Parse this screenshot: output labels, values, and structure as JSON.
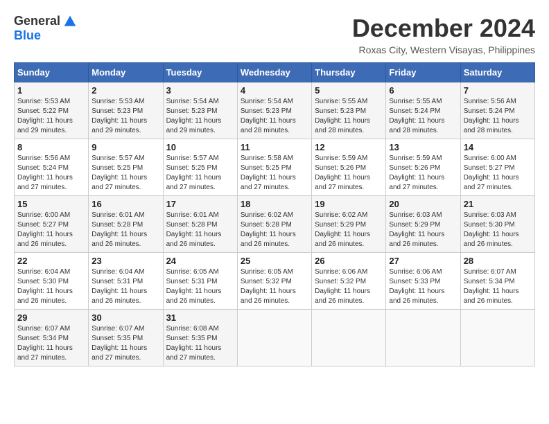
{
  "logo": {
    "general": "General",
    "blue": "Blue"
  },
  "title": {
    "month_year": "December 2024",
    "location": "Roxas City, Western Visayas, Philippines"
  },
  "headers": [
    "Sunday",
    "Monday",
    "Tuesday",
    "Wednesday",
    "Thursday",
    "Friday",
    "Saturday"
  ],
  "weeks": [
    [
      {
        "day": "1",
        "sunrise": "5:53 AM",
        "sunset": "5:22 PM",
        "daylight": "11 hours and 29 minutes."
      },
      {
        "day": "2",
        "sunrise": "5:53 AM",
        "sunset": "5:23 PM",
        "daylight": "11 hours and 29 minutes."
      },
      {
        "day": "3",
        "sunrise": "5:54 AM",
        "sunset": "5:23 PM",
        "daylight": "11 hours and 29 minutes."
      },
      {
        "day": "4",
        "sunrise": "5:54 AM",
        "sunset": "5:23 PM",
        "daylight": "11 hours and 28 minutes."
      },
      {
        "day": "5",
        "sunrise": "5:55 AM",
        "sunset": "5:23 PM",
        "daylight": "11 hours and 28 minutes."
      },
      {
        "day": "6",
        "sunrise": "5:55 AM",
        "sunset": "5:24 PM",
        "daylight": "11 hours and 28 minutes."
      },
      {
        "day": "7",
        "sunrise": "5:56 AM",
        "sunset": "5:24 PM",
        "daylight": "11 hours and 28 minutes."
      }
    ],
    [
      {
        "day": "8",
        "sunrise": "5:56 AM",
        "sunset": "5:24 PM",
        "daylight": "11 hours and 27 minutes."
      },
      {
        "day": "9",
        "sunrise": "5:57 AM",
        "sunset": "5:25 PM",
        "daylight": "11 hours and 27 minutes."
      },
      {
        "day": "10",
        "sunrise": "5:57 AM",
        "sunset": "5:25 PM",
        "daylight": "11 hours and 27 minutes."
      },
      {
        "day": "11",
        "sunrise": "5:58 AM",
        "sunset": "5:25 PM",
        "daylight": "11 hours and 27 minutes."
      },
      {
        "day": "12",
        "sunrise": "5:59 AM",
        "sunset": "5:26 PM",
        "daylight": "11 hours and 27 minutes."
      },
      {
        "day": "13",
        "sunrise": "5:59 AM",
        "sunset": "5:26 PM",
        "daylight": "11 hours and 27 minutes."
      },
      {
        "day": "14",
        "sunrise": "6:00 AM",
        "sunset": "5:27 PM",
        "daylight": "11 hours and 27 minutes."
      }
    ],
    [
      {
        "day": "15",
        "sunrise": "6:00 AM",
        "sunset": "5:27 PM",
        "daylight": "11 hours and 26 minutes."
      },
      {
        "day": "16",
        "sunrise": "6:01 AM",
        "sunset": "5:28 PM",
        "daylight": "11 hours and 26 minutes."
      },
      {
        "day": "17",
        "sunrise": "6:01 AM",
        "sunset": "5:28 PM",
        "daylight": "11 hours and 26 minutes."
      },
      {
        "day": "18",
        "sunrise": "6:02 AM",
        "sunset": "5:28 PM",
        "daylight": "11 hours and 26 minutes."
      },
      {
        "day": "19",
        "sunrise": "6:02 AM",
        "sunset": "5:29 PM",
        "daylight": "11 hours and 26 minutes."
      },
      {
        "day": "20",
        "sunrise": "6:03 AM",
        "sunset": "5:29 PM",
        "daylight": "11 hours and 26 minutes."
      },
      {
        "day": "21",
        "sunrise": "6:03 AM",
        "sunset": "5:30 PM",
        "daylight": "11 hours and 26 minutes."
      }
    ],
    [
      {
        "day": "22",
        "sunrise": "6:04 AM",
        "sunset": "5:30 PM",
        "daylight": "11 hours and 26 minutes."
      },
      {
        "day": "23",
        "sunrise": "6:04 AM",
        "sunset": "5:31 PM",
        "daylight": "11 hours and 26 minutes."
      },
      {
        "day": "24",
        "sunrise": "6:05 AM",
        "sunset": "5:31 PM",
        "daylight": "11 hours and 26 minutes."
      },
      {
        "day": "25",
        "sunrise": "6:05 AM",
        "sunset": "5:32 PM",
        "daylight": "11 hours and 26 minutes."
      },
      {
        "day": "26",
        "sunrise": "6:06 AM",
        "sunset": "5:32 PM",
        "daylight": "11 hours and 26 minutes."
      },
      {
        "day": "27",
        "sunrise": "6:06 AM",
        "sunset": "5:33 PM",
        "daylight": "11 hours and 26 minutes."
      },
      {
        "day": "28",
        "sunrise": "6:07 AM",
        "sunset": "5:34 PM",
        "daylight": "11 hours and 26 minutes."
      }
    ],
    [
      {
        "day": "29",
        "sunrise": "6:07 AM",
        "sunset": "5:34 PM",
        "daylight": "11 hours and 27 minutes."
      },
      {
        "day": "30",
        "sunrise": "6:07 AM",
        "sunset": "5:35 PM",
        "daylight": "11 hours and 27 minutes."
      },
      {
        "day": "31",
        "sunrise": "6:08 AM",
        "sunset": "5:35 PM",
        "daylight": "11 hours and 27 minutes."
      },
      null,
      null,
      null,
      null
    ]
  ],
  "labels": {
    "sunrise": "Sunrise:",
    "sunset": "Sunset:",
    "daylight": "Daylight:"
  }
}
